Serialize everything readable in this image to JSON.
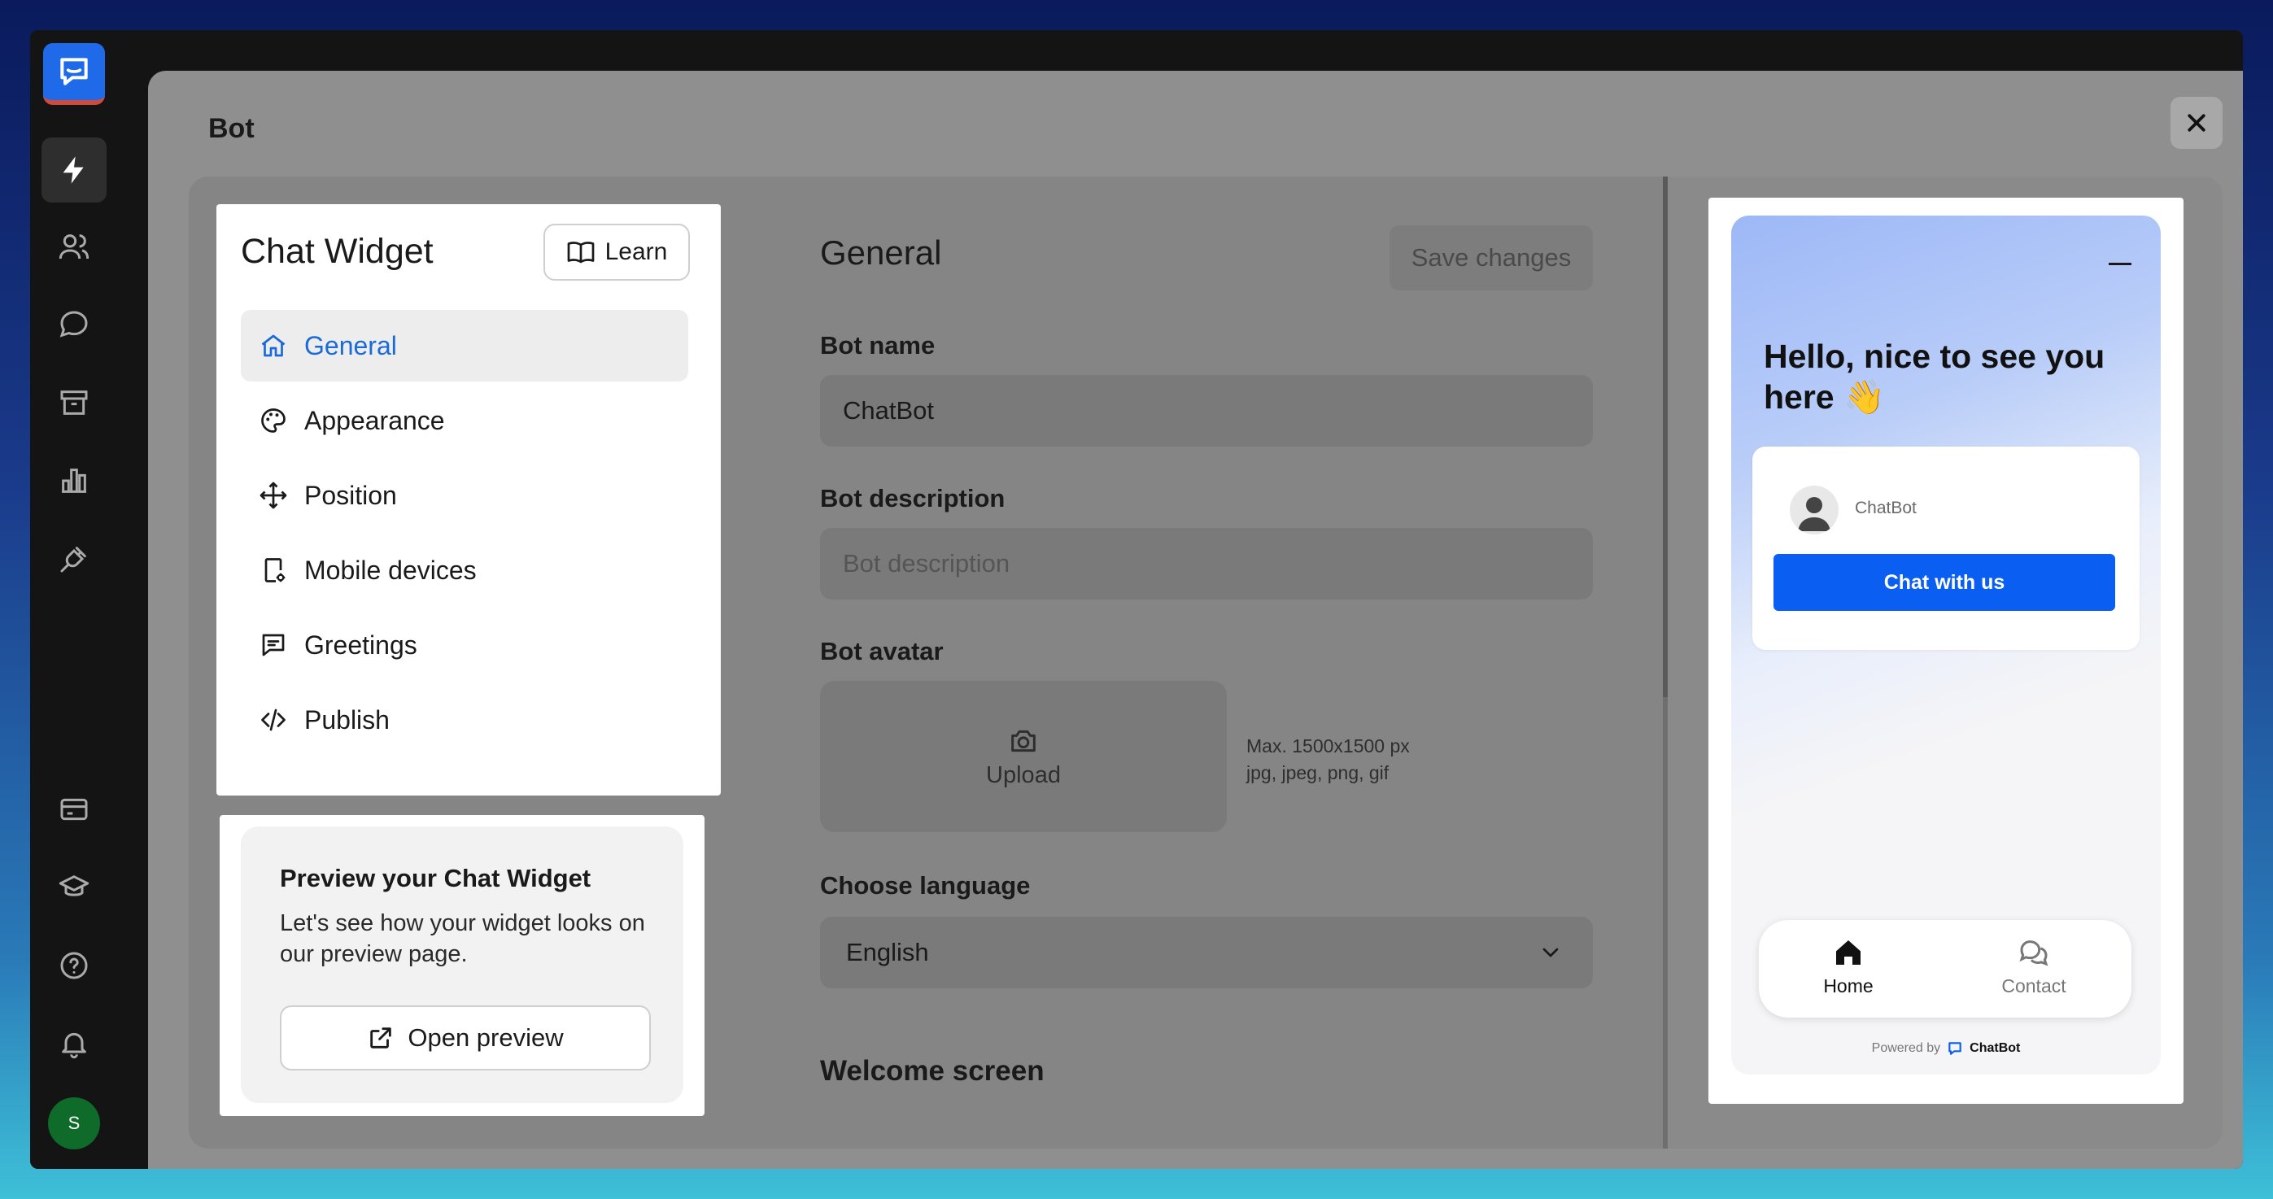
{
  "modal": {
    "title": "Bot"
  },
  "menu": {
    "title": "Chat Widget",
    "learn_label": "Learn",
    "items": [
      {
        "label": "General",
        "icon": "home-icon",
        "active": true
      },
      {
        "label": "Appearance",
        "icon": "palette-icon",
        "active": false
      },
      {
        "label": "Position",
        "icon": "move-icon",
        "active": false
      },
      {
        "label": "Mobile devices",
        "icon": "mobile-settings-icon",
        "active": false
      },
      {
        "label": "Greetings",
        "icon": "message-icon",
        "active": false
      },
      {
        "label": "Publish",
        "icon": "code-icon",
        "active": false
      }
    ]
  },
  "preview_card": {
    "title": "Preview your Chat Widget",
    "text": "Let's see how your widget looks on our preview page.",
    "button_label": "Open preview"
  },
  "form": {
    "title": "General",
    "save_label": "Save changes",
    "bot_name_label": "Bot name",
    "bot_name_value": "ChatBot",
    "bot_description_label": "Bot description",
    "bot_description_placeholder": "Bot description",
    "bot_avatar_label": "Bot avatar",
    "upload_label": "Upload",
    "upload_hint_size": "Max. 1500x1500 px",
    "upload_hint_types": "jpg, jpeg, png, gif",
    "language_label": "Choose language",
    "language_value": "English",
    "welcome_title": "Welcome screen"
  },
  "widget": {
    "greeting": "Hello, nice to see you here 👋",
    "bot_name": "ChatBot",
    "chat_button": "Chat with us",
    "tab_home": "Home",
    "tab_contact": "Contact",
    "powered_by": "Powered by",
    "brand": "ChatBot",
    "accent_color": "#0a5ef2"
  },
  "rail": {
    "avatar_initial": "S"
  }
}
